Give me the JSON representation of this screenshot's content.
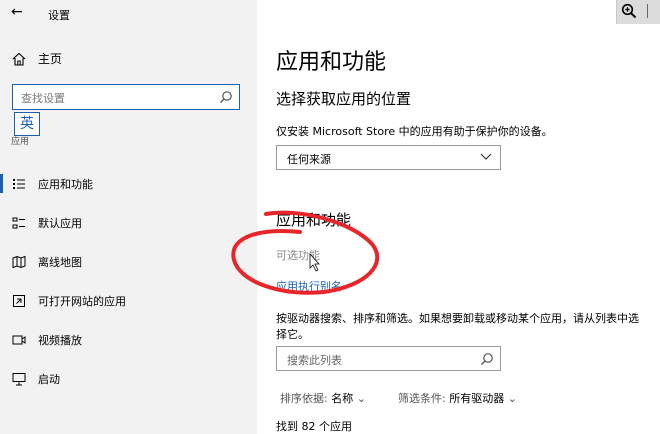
{
  "window": {
    "title": "设置"
  },
  "sidebar": {
    "home_label": "主页",
    "search_placeholder": "查找设置",
    "ime_indicator": "英",
    "section_crumb": "应用",
    "items": [
      {
        "label": "应用和功能",
        "icon": "list-icon",
        "active": true
      },
      {
        "label": "默认应用",
        "icon": "default-apps-icon",
        "active": false
      },
      {
        "label": "离线地图",
        "icon": "map-icon",
        "active": false
      },
      {
        "label": "可打开网站的应用",
        "icon": "open-website-icon",
        "active": false
      },
      {
        "label": "视频播放",
        "icon": "video-icon",
        "active": false
      },
      {
        "label": "启动",
        "icon": "startup-icon",
        "active": false
      }
    ]
  },
  "main": {
    "title": "应用和功能",
    "install_section": {
      "heading": "选择获取应用的位置",
      "description": "仅安装 Microsoft Store 中的应用有助于保护你的设备。",
      "dropdown_value": "任何来源"
    },
    "apps_section": {
      "heading": "应用和功能",
      "optional_features_link": "可选功能",
      "app_alias_link": "应用执行别名",
      "description": "按驱动器搜索、排序和筛选。如果想要卸载或移动某个应用，请从列表中选择它。",
      "search_placeholder": "搜索此列表",
      "sort_label": "排序依据:",
      "sort_value": "名称",
      "filter_label": "筛选条件:",
      "filter_value": "所有驱动器",
      "count_text": "找到 82 个应用"
    }
  },
  "colors": {
    "accent": "#1a5fb4",
    "annotation": "#e8262a",
    "sidebar_bg": "#f2f2f2"
  }
}
